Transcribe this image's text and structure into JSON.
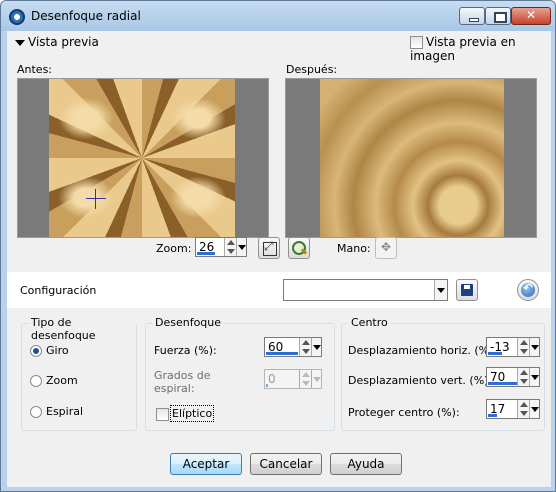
{
  "window": {
    "title": "Desenfoque radial"
  },
  "preview": {
    "toggle_label": "Vista previa",
    "image_preview_label": "Vista previa en imagen",
    "before_label": "Antes:",
    "after_label": "Después:",
    "zoom_label": "Zoom:",
    "zoom_value": "26",
    "hand_label": "Mano:"
  },
  "settings": {
    "label": "Configuración",
    "combo_value": ""
  },
  "blur_type": {
    "title": "Tipo de desenfoque",
    "options": [
      "Giro",
      "Zoom",
      "Espiral"
    ],
    "selected": "Giro"
  },
  "blur": {
    "title": "Desenfoque",
    "strength_label": "Fuerza (%):",
    "strength_value": "60",
    "spiral_label_1": "Grados de",
    "spiral_label_2": "espiral:",
    "spiral_value": "0",
    "elliptical_label": "Elíptico"
  },
  "center": {
    "title": "Centro",
    "horiz_label": "Desplazamiento horiz. (%):",
    "horiz_value": "-13",
    "vert_label": "Desplazamiento vert. (%):",
    "vert_value": "70",
    "protect_label": "Proteger centro (%):",
    "protect_value": "17"
  },
  "buttons": {
    "ok": "Aceptar",
    "cancel": "Cancelar",
    "help": "Ayuda"
  },
  "colors": {
    "title_bar": "#b9d1ea",
    "accent": "#2a6fd3",
    "dialog_bg": "#f0f0f0"
  }
}
